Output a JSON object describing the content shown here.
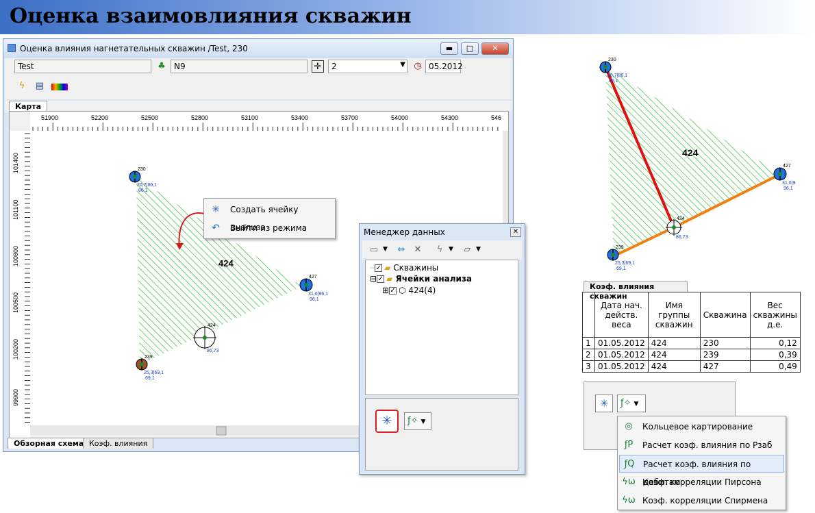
{
  "banner": {
    "title": "Оценка взаимовлияния скважин"
  },
  "window": {
    "title": "Оценка влияния нагнетательных скважин /Test, 230",
    "buttons": {
      "minimize": "▬",
      "maximize": "□",
      "close": "✕"
    },
    "toolbar": {
      "project_field": "Test",
      "well_field": "N9",
      "scale_select": "2",
      "date_field": "05.2012"
    },
    "top_tab": "Карта",
    "bottom_tabs": [
      "Обзорная схема",
      "Коэф. влияния"
    ]
  },
  "map": {
    "x_ticks": [
      "51900",
      "52200",
      "52500",
      "52800",
      "53100",
      "53400",
      "53700",
      "54000",
      "54300",
      "546"
    ],
    "y_ticks": [
      "101400",
      "101100",
      "100800",
      "100500",
      "100200",
      "99900"
    ],
    "cell_label": "424",
    "wells": [
      {
        "name": "230",
        "label1": "20,7|86,1",
        "label2": "86,1",
        "color": "#1f6fe0"
      },
      {
        "name": "427",
        "label1": "31,6|96,1",
        "label2": "96,1",
        "color": "#1f6fe0"
      },
      {
        "name": "239",
        "label1": "25,3|69,1",
        "label2": "69,1",
        "color": "#a0522d"
      },
      {
        "name": "424",
        "label1": "86,73",
        "label2": "",
        "color": "#ffffff"
      }
    ]
  },
  "context_menu": {
    "items": [
      "Создать ячейку анализа",
      "Выйти из режима"
    ]
  },
  "data_manager": {
    "title": "Менеджер данных",
    "tree": [
      {
        "label": "Скважины",
        "bold": false
      },
      {
        "label": "Ячейки анализа",
        "bold": true
      },
      {
        "label": "424(4)",
        "bold": false
      }
    ]
  },
  "right_diagram": {
    "cell_label": "424",
    "wells": [
      {
        "name": "230",
        "label1": "20,7|86,1",
        "label2": "86,1"
      },
      {
        "name": "427",
        "label1": "31,6|96,1",
        "label2": "96,1"
      },
      {
        "name": "239",
        "label1": "25,3|69,1",
        "label2": "69,1"
      },
      {
        "name": "424",
        "label1": "86,73",
        "label2": ""
      }
    ]
  },
  "coef_table": {
    "tab_label": "Коэф. влияния скважин",
    "headers": [
      "Дата нач. действ. веса",
      "Имя группы скважин",
      "Скважина",
      "Вес скважины д.е."
    ],
    "rows": [
      [
        "1",
        "01.05.2012",
        "424",
        "230",
        "0,12"
      ],
      [
        "2",
        "01.05.2012",
        "424",
        "239",
        "0,39"
      ],
      [
        "3",
        "01.05.2012",
        "424",
        "427",
        "0,49"
      ]
    ]
  },
  "dropdown_menu": {
    "items": [
      "Кольцевое картирование",
      "Расчет коэф. влияния по Pзаб",
      "Расчет коэф. влияния по дебитам",
      "Коэф. корреляции Пирсона",
      "Коэф. корреляции Спирмена"
    ],
    "highlighted_index": 2
  },
  "colors": {
    "hatch": "#3cc23c",
    "line_red": "#e01010",
    "line_orange": "#f08010",
    "title_gradient": "#3c6fc6"
  }
}
